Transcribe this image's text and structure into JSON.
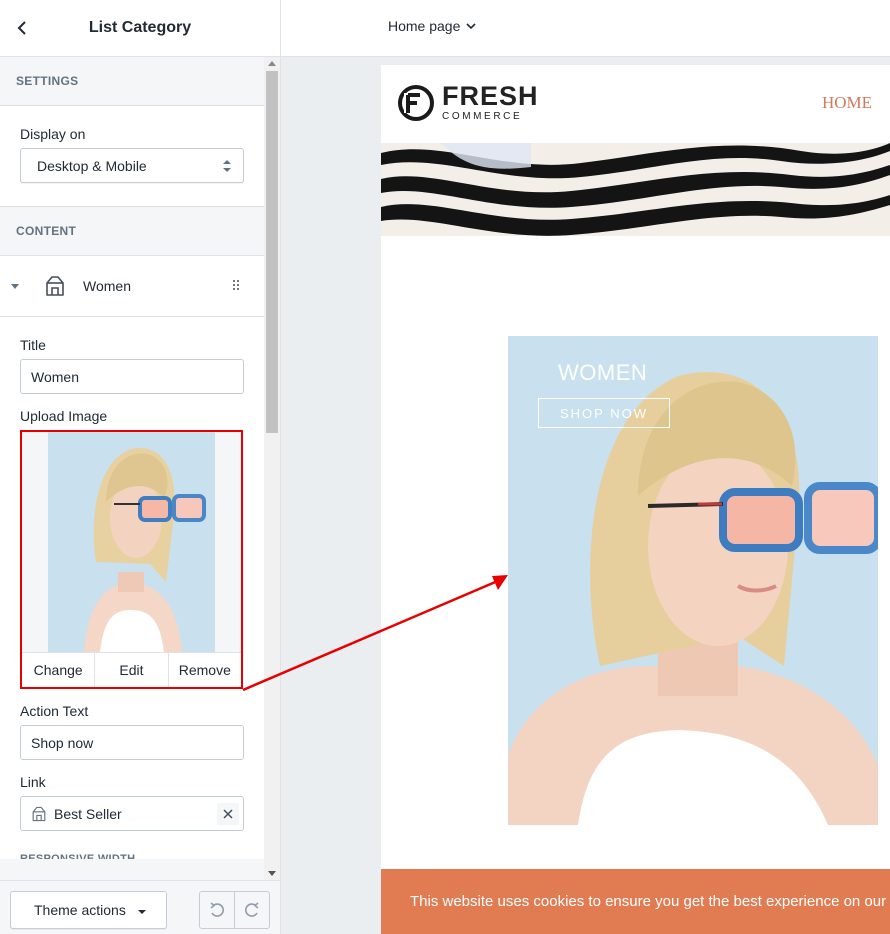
{
  "sidebar": {
    "title": "List Category",
    "sections": {
      "settings": "SETTINGS",
      "content": "CONTENT"
    },
    "display_on": {
      "label": "Display on",
      "value": "Desktop & Mobile"
    },
    "block": {
      "name": "Women",
      "icon": "collection-icon",
      "title_label": "Title",
      "title_value": "Women",
      "upload_label": "Upload Image",
      "upload_actions": {
        "change": "Change",
        "edit": "Edit",
        "remove": "Remove"
      },
      "action_text_label": "Action Text",
      "action_text_value": "Shop now",
      "link_label": "Link",
      "link_value": "Best Seller",
      "next_heading": "RESPONSIVE WIDTH"
    },
    "footer": {
      "theme_actions": "Theme actions"
    }
  },
  "topbar": {
    "page_selector": "Home page"
  },
  "preview": {
    "logo": {
      "brand": "FRESH",
      "tagline": "COMMERCE"
    },
    "nav": {
      "home": "HOME"
    },
    "category": {
      "title": "WOMEN",
      "button": "SHOP NOW"
    },
    "cookie_text": "This website uses cookies to ensure you get the best experience on our website."
  },
  "colors": {
    "accent_red": "#e60000",
    "nav_link": "#d3795a",
    "cookie_bar": "#e07b52",
    "category_bg": "#c9e0ef"
  }
}
